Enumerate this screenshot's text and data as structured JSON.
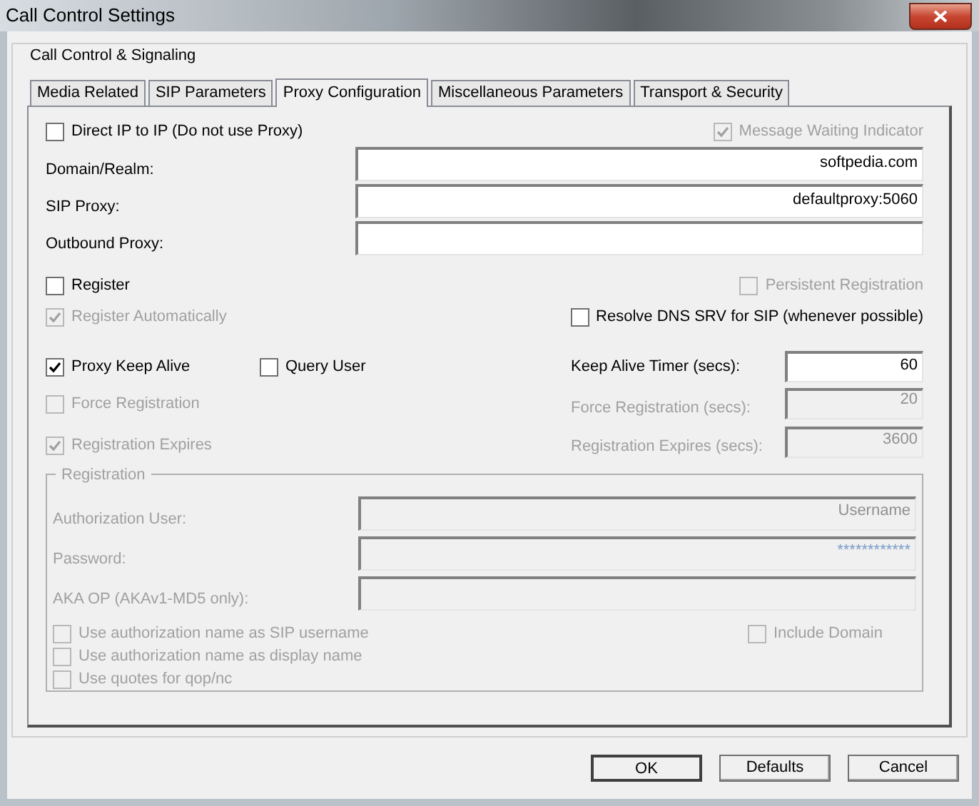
{
  "window": {
    "title": "Call Control Settings"
  },
  "group": {
    "title": "Call Control & Signaling"
  },
  "tabs": [
    {
      "label": "Media Related",
      "selected": false
    },
    {
      "label": "SIP Parameters",
      "selected": false
    },
    {
      "label": "Proxy Configuration",
      "selected": true
    },
    {
      "label": "Miscellaneous Parameters",
      "selected": false
    },
    {
      "label": "Transport & Security",
      "selected": false
    }
  ],
  "direct_ip": {
    "label": "Direct IP to IP (Do not use Proxy)",
    "checked": false,
    "disabled": false
  },
  "message_waiting": {
    "label": "Message Waiting Indicator",
    "checked": true,
    "disabled": true
  },
  "fields": [
    {
      "label": "Domain/Realm:",
      "value": "softpedia.com"
    },
    {
      "label": "SIP Proxy:",
      "value": "defaultproxy:5060"
    },
    {
      "label": "Outbound Proxy:"
    }
  ],
  "register": {
    "label": "Register",
    "checked": false,
    "disabled": false
  },
  "persistent_registration": {
    "label": "Persistent Registration",
    "checked": false,
    "disabled": true
  },
  "register_automatically": {
    "label": "Register Automatically",
    "checked": true,
    "disabled": true
  },
  "resolve_dns_srv": {
    "label": "Resolve DNS SRV for SIP (whenever possible)",
    "checked": false,
    "disabled": false
  },
  "proxy_keep_alive": {
    "label": "Proxy Keep Alive",
    "checked": true,
    "disabled": false
  },
  "query_user": {
    "label": "Query User",
    "checked": false,
    "disabled": false
  },
  "keep_alive_timer": {
    "label": "Keep Alive Timer (secs):",
    "value": "60",
    "disabled": false
  },
  "force_registration": {
    "label": "Force Registration",
    "checked": false,
    "disabled": true
  },
  "force_registration_secs": {
    "label": "Force Registration (secs):",
    "value": "20",
    "disabled": true
  },
  "registration_expires": {
    "label": "Registration Expires",
    "checked": true,
    "disabled": true
  },
  "registration_expires_secs": {
    "label": "Registration Expires (secs):",
    "value": "3600",
    "disabled": true
  },
  "registration": {
    "title": "Registration",
    "fields": [
      {
        "label": "Authorization User:",
        "value": "Username",
        "kind": "text",
        "disabled": true
      },
      {
        "label": "Password:",
        "value": "************",
        "kind": "password",
        "disabled": true
      },
      {
        "label": "AKA OP (AKAv1-MD5 only):",
        "kind": "text",
        "disabled": true
      }
    ],
    "options": [
      {
        "label": "Use authorization name as SIP username",
        "checked": false,
        "disabled": true
      },
      {
        "label": "Use authorization name as display name",
        "checked": false,
        "disabled": true
      },
      {
        "label": "Use quotes for qop/nc",
        "checked": false,
        "disabled": true
      }
    ],
    "include_domain": {
      "label": "Include Domain",
      "checked": false,
      "disabled": true
    }
  },
  "buttons": [
    {
      "label": "OK",
      "default": true
    },
    {
      "label": "Defaults",
      "default": false
    },
    {
      "label": "Cancel",
      "default": false
    }
  ]
}
